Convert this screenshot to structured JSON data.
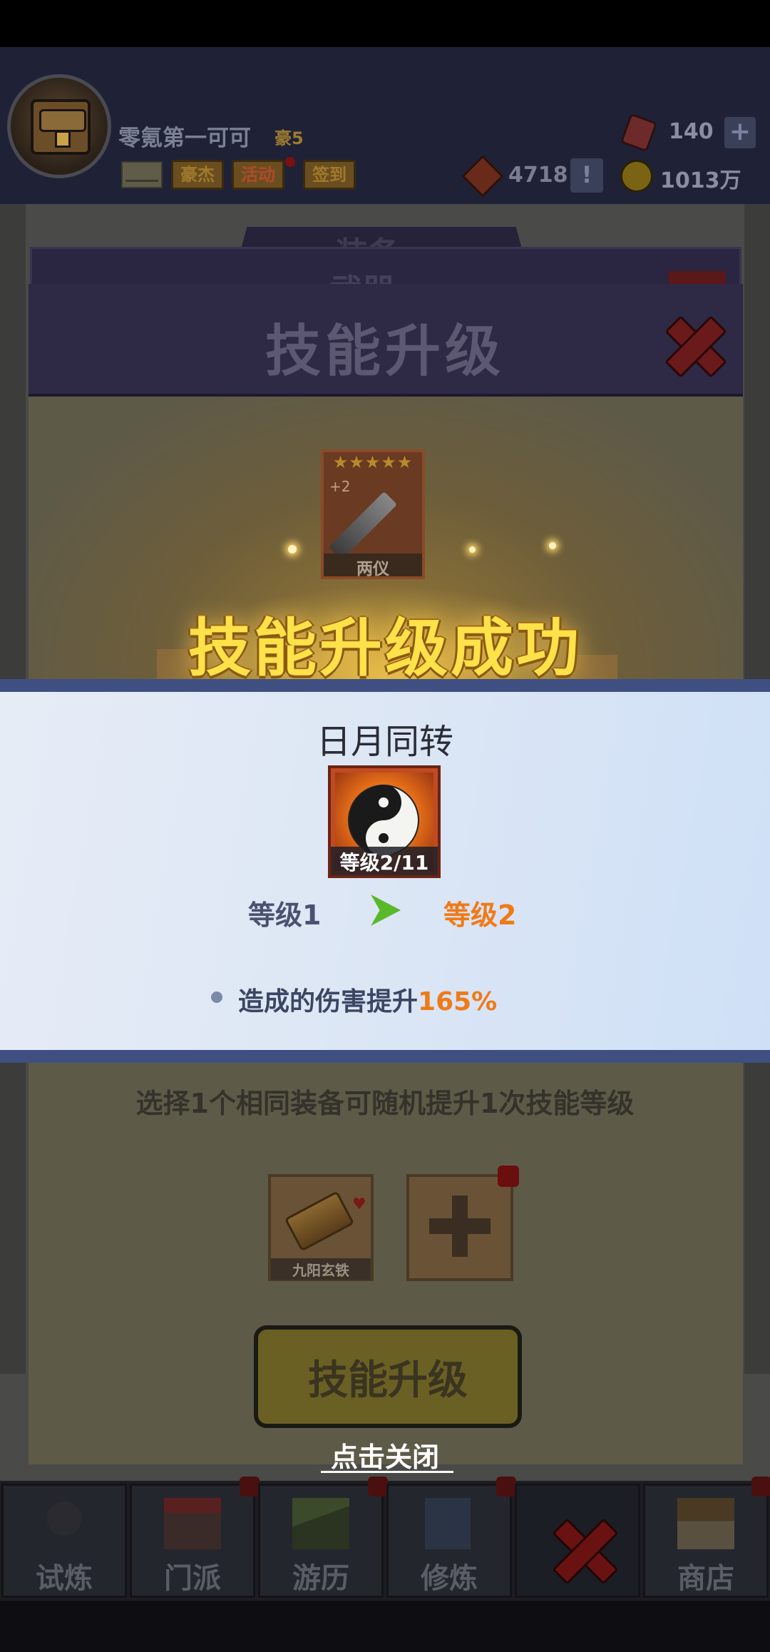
{
  "header": {
    "player_name": "零氪第一可可",
    "vip_label": "豪5",
    "buttons": {
      "haojie": "豪杰",
      "huodong": "活动",
      "qiandao": "签到"
    },
    "gems": "140",
    "gem_plus": "+",
    "tokens": "4718",
    "token_alert": "!",
    "coins": "1013万"
  },
  "back_dialogs": {
    "title1": "装备",
    "title2": "武器"
  },
  "dialog": {
    "title": "技能升级",
    "equipment": {
      "stars": "★★★★★",
      "plus": "+2",
      "name": "两仪"
    },
    "success_text": "技能升级成功"
  },
  "result": {
    "skill_name": "日月同转",
    "skill_level": "等级2/11",
    "level_from": "等级1",
    "level_to": "等级2",
    "effect_text": "造成的伤害提升",
    "effect_value": "165%"
  },
  "below": {
    "select_hint": "选择1个相同装备可随机提升1次技能等级",
    "slot1_label": "九阳玄铁",
    "upgrade_button": "技能升级",
    "close_hint": "点击关闭"
  },
  "nav": {
    "tabs": [
      "试炼",
      "门派",
      "游历",
      "修炼",
      "",
      "商店"
    ]
  },
  "colors": {
    "success_gold": "#ffe14a",
    "highlight_orange": "#f07a18",
    "panel_border": "#3f4f82"
  }
}
